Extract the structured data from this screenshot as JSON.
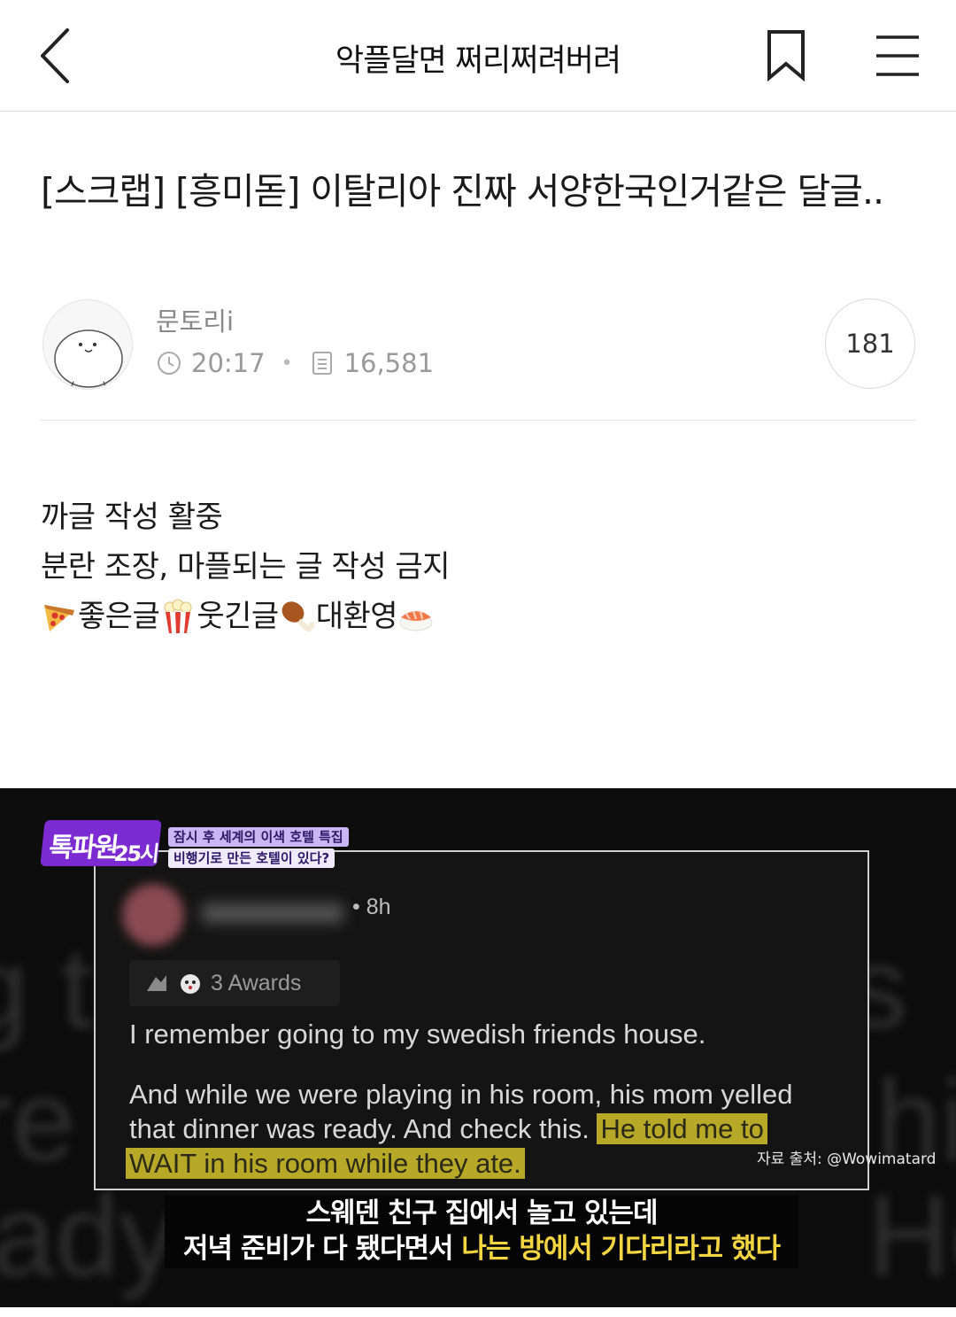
{
  "topbar": {
    "board_title": "악플달면 쩌리쩌려버려",
    "back_icon": "chevron-left-icon",
    "bookmark_icon": "bookmark-icon",
    "menu_icon": "hamburger-menu-icon"
  },
  "post": {
    "title": "[스크랩] [흥미돋] 이탈리아 진짜 서양한국인거같은 달글..",
    "author": "문토리i",
    "time": "20:17",
    "views": "16,581",
    "comment_count": "181"
  },
  "body": {
    "line1": "까글 작성 활중",
    "line2": "분란 조장, 마플되는 글 작성 금지",
    "line3_parts": [
      "좋은글",
      "웃긴글",
      "대환영"
    ],
    "line3_icons": [
      "pizza-icon",
      "popcorn-icon",
      "chicken-leg-icon",
      "sushi-icon"
    ]
  },
  "capture": {
    "badge_title": "톡파원",
    "badge_number": "25시",
    "badge_sub1": "잠시 후 세계의 이색 호텔 특집",
    "badge_sub2": "비행기로 만든 호텔이 있다?",
    "card_time": "• 8h",
    "awards": "3 Awards",
    "comment_line1": "I remember going to my swedish friends house.",
    "comment_line2a": "And while we were playing in his room, his mom yelled",
    "comment_line2b": "that dinner was ready. And check this.",
    "comment_highlight1": "He told me to",
    "comment_highlight2": "WAIT in his room while they ate.",
    "source": "자료 출처: @Wowimatard",
    "subtitle_line1": "스웨덴 친구 집에서 놀고 있는데",
    "subtitle_line2_white": "저녁 준비가 다 됐다면서 ",
    "subtitle_line2_yellow": "나는 방에서 기다리라고 했다",
    "highlight_color": "#b7a827",
    "subtitle_accent": "#f3d542",
    "badge_color": "#7b2bd1"
  }
}
